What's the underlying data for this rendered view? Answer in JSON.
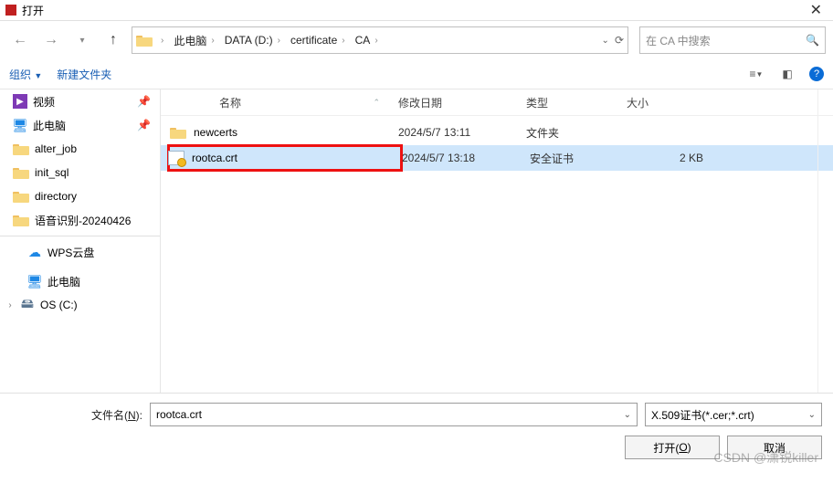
{
  "title": "打开",
  "nav": {
    "back": "←",
    "fwd": "→",
    "up": "↑"
  },
  "breadcrumb": [
    "此电脑",
    "DATA (D:)",
    "certificate",
    "CA"
  ],
  "search_placeholder": "在 CA 中搜索",
  "toolbar": {
    "organize": "组织",
    "newfolder": "新建文件夹"
  },
  "sidebar": {
    "items": [
      {
        "name": "video",
        "label": "视频",
        "icon": "🎬",
        "pinned": true
      },
      {
        "name": "thispc",
        "label": "此电脑",
        "icon": "💻",
        "pinned": true
      },
      {
        "name": "alterjob",
        "label": "alter_job",
        "icon": "📁",
        "pinned": false
      },
      {
        "name": "initsql",
        "label": "init_sql",
        "icon": "📁",
        "pinned": false
      },
      {
        "name": "directory",
        "label": "directory",
        "icon": "📁",
        "pinned": false
      },
      {
        "name": "speech",
        "label": "语音识别-20240426",
        "icon": "📁",
        "pinned": false
      }
    ],
    "items2": [
      {
        "name": "wps",
        "label": "WPS云盘",
        "icon": "☁",
        "color": "#1e88e5"
      },
      {
        "name": "thispc2",
        "label": "此电脑",
        "icon": "💻",
        "color": "#1e88e5"
      },
      {
        "name": "osc",
        "label": "OS (C:)",
        "icon": "🖴",
        "expander": "›"
      }
    ]
  },
  "columns": {
    "name": "名称",
    "modified": "修改日期",
    "type": "类型",
    "size": "大小"
  },
  "rows": [
    {
      "name": "newcerts",
      "modified": "2024/5/7 13:11",
      "type": "文件夹",
      "size": "",
      "kind": "folder",
      "selected": false
    },
    {
      "name": "rootca.crt",
      "modified": "2024/5/7 13:18",
      "type": "安全证书",
      "size": "2 KB",
      "kind": "cert",
      "selected": true,
      "highlight": true
    }
  ],
  "footer": {
    "filename_label_pre": "文件名(",
    "filename_label_u": "N",
    "filename_label_post": "):",
    "filename_value": "rootca.crt",
    "filter": "X.509证书(*.cer;*.crt)",
    "open_pre": "打开(",
    "open_u": "O",
    "open_post": ")",
    "cancel": "取消"
  },
  "watermark": "CSDN @潇锐killer"
}
